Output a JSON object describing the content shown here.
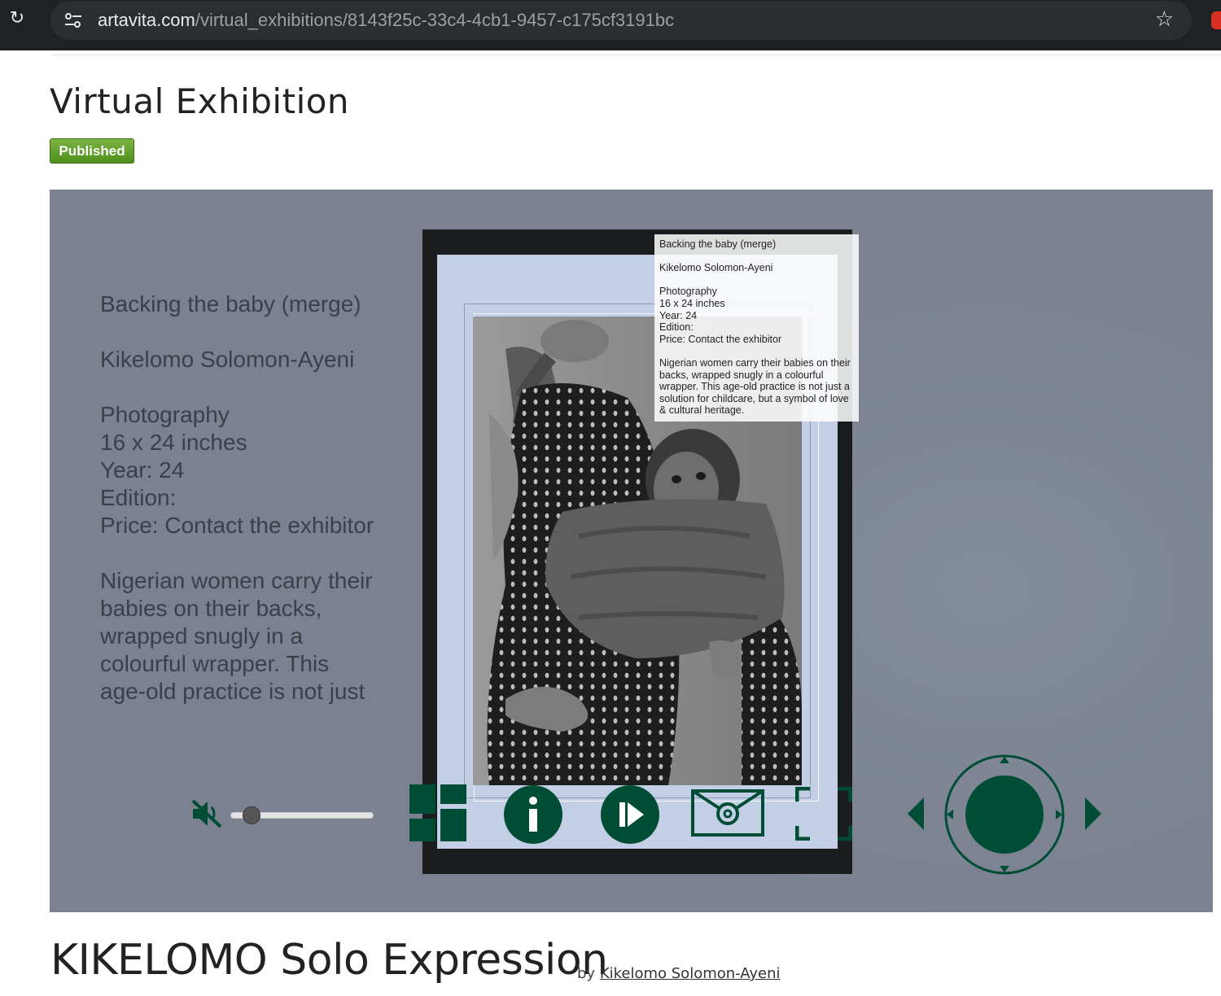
{
  "browser": {
    "url_host": "artavita.com",
    "url_path": "/virtual_exhibitions/8143f25c-33c4-4cb1-9457-c175cf3191bc"
  },
  "page": {
    "title": "Virtual Exhibition",
    "status_badge": "Published"
  },
  "artwork": {
    "title": "Backing the baby (merge)",
    "artist": "Kikelomo Solomon-Ayeni",
    "medium": "Photography",
    "size": "16 x 24 inches",
    "year": "Year: 24",
    "edition": "Edition:",
    "price": "Price: Contact the exhibitor",
    "description_visible": [
      "Nigerian women carry their",
      "babies on their backs,",
      "wrapped snugly in a",
      "colourful wrapper. This",
      "age-old practice is not just"
    ],
    "description_full": "Nigerian women carry their babies on their backs, wrapped snugly in a colourful wrapper. This age-old practice is not just a solution for childcare, but a symbol of love & cultural heritage."
  },
  "player": {
    "volume_fraction": 0.1
  },
  "exhibition": {
    "title": "KIKELOMO Solo Expression",
    "by_label": "by",
    "author": "Kikelomo Solomon-Ayeni"
  },
  "colors": {
    "control_green": "#004d35",
    "stage_bg": "#7b8190",
    "badge_green": "#5c9e22"
  },
  "icons": [
    "reload-icon",
    "site-settings-icon",
    "bookmark-star-icon",
    "mute-icon",
    "grid-icon",
    "info-icon",
    "play-icon",
    "email-icon",
    "fullscreen-icon",
    "arrow-left-icon",
    "navigation-joystick-icon",
    "arrow-right-icon"
  ]
}
